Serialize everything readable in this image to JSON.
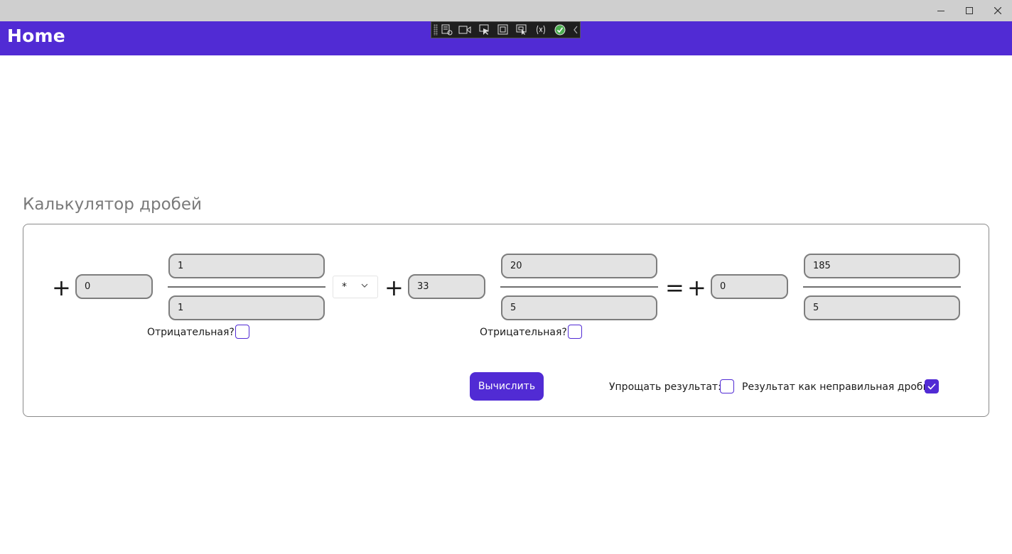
{
  "window": {
    "minimize_glyph": "—",
    "maximize_glyph": "☐",
    "close_glyph": "✕"
  },
  "header": {
    "title": "Home",
    "color": "#512bd4"
  },
  "dev_toolbar": {
    "icons": [
      "app-toolbar-icon",
      "video-camera-icon",
      "select-element-icon",
      "display-layout-adorners-icon",
      "track-focused-element-icon",
      "binding-failures-icon",
      "hot-reload-status-icon",
      "collapse-toolbar-icon"
    ]
  },
  "page": {
    "heading": "Калькулятор дробей"
  },
  "left_fraction": {
    "sign": "+",
    "whole": "0",
    "numerator": "1",
    "denominator": "1",
    "negative_label": "Отрицательная?",
    "negative_checked": false
  },
  "operator": {
    "selected": "*"
  },
  "right_fraction": {
    "sign": "+",
    "whole": "33",
    "numerator": "20",
    "denominator": "5",
    "negative_label": "Отрицательная?",
    "negative_checked": false
  },
  "equals": "=",
  "result_fraction": {
    "sign": "+",
    "whole": "0",
    "numerator": "185",
    "denominator": "5"
  },
  "actions": {
    "calculate_label": "Вычислить",
    "simplify_label": "Упрощать результат:",
    "simplify_checked": false,
    "improper_label": "Результат как неправильная дробь:",
    "improper_checked": true
  },
  "colors": {
    "accent": "#512bd4",
    "entry_bg": "#e3e3e3",
    "entry_border": "#7d7d7d"
  }
}
